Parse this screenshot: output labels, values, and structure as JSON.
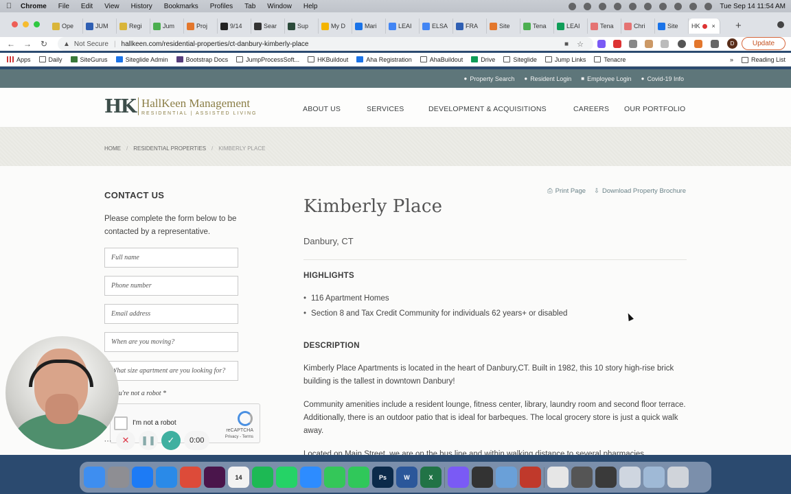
{
  "menubar": {
    "app": "Chrome",
    "items": [
      "File",
      "Edit",
      "View",
      "History",
      "Bookmarks",
      "Profiles",
      "Tab",
      "Window",
      "Help"
    ],
    "datetime": "Tue Sep 14  11:54 AM"
  },
  "tabs": [
    {
      "label": "Ope",
      "color": "#d9b53a"
    },
    {
      "label": "JUM",
      "color": "#2f5fb3"
    },
    {
      "label": "Regi",
      "color": "#d9b53a"
    },
    {
      "label": "Jum",
      "color": "#4caf50"
    },
    {
      "label": "Proj",
      "color": "#e3772d"
    },
    {
      "label": "9/14",
      "color": "#222"
    },
    {
      "label": "Sear",
      "color": "#333"
    },
    {
      "label": "Sup",
      "color": "#2b4a3a"
    },
    {
      "label": "My D",
      "color": "#f4b400"
    },
    {
      "label": "Mari",
      "color": "#1a73e8"
    },
    {
      "label": "LEAI",
      "color": "#4285f4"
    },
    {
      "label": "ELSA",
      "color": "#4285f4"
    },
    {
      "label": "FRA",
      "color": "#2f5fb3"
    },
    {
      "label": "Site",
      "color": "#e3772d"
    },
    {
      "label": "Tena",
      "color": "#4caf50"
    },
    {
      "label": "LEAI",
      "color": "#0f9d58"
    },
    {
      "label": "Tena",
      "color": "#e57373"
    },
    {
      "label": "Chri",
      "color": "#e57373"
    },
    {
      "label": "Site",
      "color": "#1a73e8"
    }
  ],
  "active_tab": {
    "label": "HK",
    "close": "×"
  },
  "toolbar": {
    "security": "Not Secure",
    "url": "hallkeen.com/residential-properties/ct-danbury-kimberly-place",
    "update": "Update",
    "profile_initial": "D"
  },
  "bookmarks": [
    {
      "label": "Apps",
      "type": "apps"
    },
    {
      "label": "Daily",
      "type": "folder"
    },
    {
      "label": "SiteGurus",
      "type": "site",
      "color": "#3a7a3a"
    },
    {
      "label": "Siteglide Admin",
      "type": "site",
      "color": "#1a73e8"
    },
    {
      "label": "Bootstrap Docs",
      "type": "site",
      "color": "#563d7c"
    },
    {
      "label": "JumpProcessSoft...",
      "type": "folder"
    },
    {
      "label": "HKBuildout",
      "type": "folder"
    },
    {
      "label": "Aha Registration",
      "type": "site",
      "color": "#1a73e8"
    },
    {
      "label": "AhaBuildout",
      "type": "folder"
    },
    {
      "label": "Drive",
      "type": "site",
      "color": "#0f9d58"
    },
    {
      "label": "Siteglide",
      "type": "folder"
    },
    {
      "label": "Jump Links",
      "type": "folder"
    },
    {
      "label": "Tenacre",
      "type": "folder"
    }
  ],
  "reading_list": "Reading List",
  "site": {
    "utility_links": [
      "Property Search",
      "Resident Login",
      "Employee Login",
      "Covid-19 Info"
    ],
    "logo": {
      "mark": "HK",
      "name": "HallKeen Management",
      "tagline": "RESIDENTIAL   |   ASSISTED LIVING"
    },
    "nav": [
      "ABOUT US",
      "SERVICES",
      "DEVELOPMENT & ACQUISITIONS",
      "CAREERS",
      "OUR PORTFOLIO"
    ],
    "breadcrumbs": [
      "HOME",
      "RESIDENTIAL PROPERTIES",
      "KIMBERLY PLACE"
    ],
    "contact": {
      "title": "CONTACT US",
      "description": "Please complete the form below to be contacted by a representative.",
      "fields": [
        "Full name",
        "Phone number",
        "Email address",
        "When are you moving?",
        "What size apartment are you looking for?"
      ],
      "robot_label": "ve you're not a robot *",
      "captcha_label": "I'm not a robot",
      "captcha_brand": "reCAPTCHA",
      "captcha_links": "Privacy - Terms"
    },
    "actions": {
      "print": "Print Page",
      "download": "Download Property Brochure"
    },
    "property": {
      "name": "Kimberly Place",
      "location": "Danbury, CT",
      "highlights_title": "HIGHLIGHTS",
      "highlights": [
        "116 Apartment Homes",
        "Section 8 and Tax Credit Community for individuals 62 years+ or disabled"
      ],
      "description_title": "DESCRIPTION",
      "paragraphs": [
        "Kimberly Place Apartments is located in the heart of Danbury,CT. Built in 1982, this 10 story high-rise brick building is the tallest in downtown Danbury!",
        "Community amenities include a resident lounge, fitness center, library, laundry room and second floor terrace. Additionally, there is an outdoor patio that is ideal for barbeques. The local grocery store is just a quick walk away.",
        "Located on Main Street, we are on the bus line and within walking distance to several pharmacies"
      ]
    }
  },
  "recorder": {
    "time": "0:00"
  },
  "dock": [
    {
      "name": "finder",
      "color": "#3e8ef0"
    },
    {
      "name": "launchpad",
      "color": "#8e8e93"
    },
    {
      "name": "app-store-a",
      "color": "#1d7bf5"
    },
    {
      "name": "safari",
      "color": "#2a8ae8"
    },
    {
      "name": "chrome",
      "color": "#dd4b39"
    },
    {
      "name": "slack",
      "color": "#4a154b"
    },
    {
      "name": "calendar",
      "color": "#f2f2f2",
      "label": "14"
    },
    {
      "name": "spotify",
      "color": "#1db954"
    },
    {
      "name": "whatsapp",
      "color": "#25d366"
    },
    {
      "name": "zoom",
      "color": "#2d8cff"
    },
    {
      "name": "messages",
      "color": "#34c759"
    },
    {
      "name": "facetime",
      "color": "#30c85a"
    },
    {
      "name": "photoshop",
      "color": "#0b2a4a",
      "label": "Ps"
    },
    {
      "name": "word",
      "color": "#2b579a",
      "label": "W"
    },
    {
      "name": "excel",
      "color": "#217346",
      "label": "X"
    },
    {
      "name": "sep"
    },
    {
      "name": "screen-recorder",
      "color": "#7a5af5"
    },
    {
      "name": "sequel-pro",
      "color": "#333"
    },
    {
      "name": "preview",
      "color": "#6aa0d8"
    },
    {
      "name": "loom",
      "color": "#c0392b"
    },
    {
      "name": "sep"
    },
    {
      "name": "doc-stack",
      "color": "#e6e6e6"
    },
    {
      "name": "window-stack",
      "color": "#555"
    },
    {
      "name": "screenshot-stack",
      "color": "#3a3a3a"
    },
    {
      "name": "folder-stack",
      "color": "#cfd6e0"
    },
    {
      "name": "downloads",
      "color": "#9fb9d6"
    },
    {
      "name": "trash",
      "color": "#d0d4da"
    }
  ]
}
